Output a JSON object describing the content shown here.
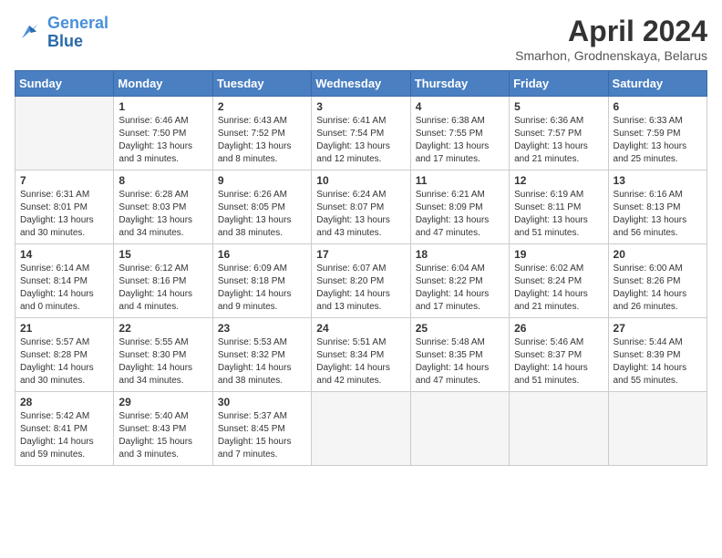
{
  "header": {
    "logo": "GeneralBlue",
    "month_title": "April 2024",
    "subtitle": "Smarhon, Grodnenskaya, Belarus"
  },
  "days_of_week": [
    "Sunday",
    "Monday",
    "Tuesday",
    "Wednesday",
    "Thursday",
    "Friday",
    "Saturday"
  ],
  "weeks": [
    [
      {
        "day": "",
        "content": []
      },
      {
        "day": "1",
        "content": [
          "Sunrise: 6:46 AM",
          "Sunset: 7:50 PM",
          "Daylight: 13 hours",
          "and 3 minutes."
        ]
      },
      {
        "day": "2",
        "content": [
          "Sunrise: 6:43 AM",
          "Sunset: 7:52 PM",
          "Daylight: 13 hours",
          "and 8 minutes."
        ]
      },
      {
        "day": "3",
        "content": [
          "Sunrise: 6:41 AM",
          "Sunset: 7:54 PM",
          "Daylight: 13 hours",
          "and 12 minutes."
        ]
      },
      {
        "day": "4",
        "content": [
          "Sunrise: 6:38 AM",
          "Sunset: 7:55 PM",
          "Daylight: 13 hours",
          "and 17 minutes."
        ]
      },
      {
        "day": "5",
        "content": [
          "Sunrise: 6:36 AM",
          "Sunset: 7:57 PM",
          "Daylight: 13 hours",
          "and 21 minutes."
        ]
      },
      {
        "day": "6",
        "content": [
          "Sunrise: 6:33 AM",
          "Sunset: 7:59 PM",
          "Daylight: 13 hours",
          "and 25 minutes."
        ]
      }
    ],
    [
      {
        "day": "7",
        "content": [
          "Sunrise: 6:31 AM",
          "Sunset: 8:01 PM",
          "Daylight: 13 hours",
          "and 30 minutes."
        ]
      },
      {
        "day": "8",
        "content": [
          "Sunrise: 6:28 AM",
          "Sunset: 8:03 PM",
          "Daylight: 13 hours",
          "and 34 minutes."
        ]
      },
      {
        "day": "9",
        "content": [
          "Sunrise: 6:26 AM",
          "Sunset: 8:05 PM",
          "Daylight: 13 hours",
          "and 38 minutes."
        ]
      },
      {
        "day": "10",
        "content": [
          "Sunrise: 6:24 AM",
          "Sunset: 8:07 PM",
          "Daylight: 13 hours",
          "and 43 minutes."
        ]
      },
      {
        "day": "11",
        "content": [
          "Sunrise: 6:21 AM",
          "Sunset: 8:09 PM",
          "Daylight: 13 hours",
          "and 47 minutes."
        ]
      },
      {
        "day": "12",
        "content": [
          "Sunrise: 6:19 AM",
          "Sunset: 8:11 PM",
          "Daylight: 13 hours",
          "and 51 minutes."
        ]
      },
      {
        "day": "13",
        "content": [
          "Sunrise: 6:16 AM",
          "Sunset: 8:13 PM",
          "Daylight: 13 hours",
          "and 56 minutes."
        ]
      }
    ],
    [
      {
        "day": "14",
        "content": [
          "Sunrise: 6:14 AM",
          "Sunset: 8:14 PM",
          "Daylight: 14 hours",
          "and 0 minutes."
        ]
      },
      {
        "day": "15",
        "content": [
          "Sunrise: 6:12 AM",
          "Sunset: 8:16 PM",
          "Daylight: 14 hours",
          "and 4 minutes."
        ]
      },
      {
        "day": "16",
        "content": [
          "Sunrise: 6:09 AM",
          "Sunset: 8:18 PM",
          "Daylight: 14 hours",
          "and 9 minutes."
        ]
      },
      {
        "day": "17",
        "content": [
          "Sunrise: 6:07 AM",
          "Sunset: 8:20 PM",
          "Daylight: 14 hours",
          "and 13 minutes."
        ]
      },
      {
        "day": "18",
        "content": [
          "Sunrise: 6:04 AM",
          "Sunset: 8:22 PM",
          "Daylight: 14 hours",
          "and 17 minutes."
        ]
      },
      {
        "day": "19",
        "content": [
          "Sunrise: 6:02 AM",
          "Sunset: 8:24 PM",
          "Daylight: 14 hours",
          "and 21 minutes."
        ]
      },
      {
        "day": "20",
        "content": [
          "Sunrise: 6:00 AM",
          "Sunset: 8:26 PM",
          "Daylight: 14 hours",
          "and 26 minutes."
        ]
      }
    ],
    [
      {
        "day": "21",
        "content": [
          "Sunrise: 5:57 AM",
          "Sunset: 8:28 PM",
          "Daylight: 14 hours",
          "and 30 minutes."
        ]
      },
      {
        "day": "22",
        "content": [
          "Sunrise: 5:55 AM",
          "Sunset: 8:30 PM",
          "Daylight: 14 hours",
          "and 34 minutes."
        ]
      },
      {
        "day": "23",
        "content": [
          "Sunrise: 5:53 AM",
          "Sunset: 8:32 PM",
          "Daylight: 14 hours",
          "and 38 minutes."
        ]
      },
      {
        "day": "24",
        "content": [
          "Sunrise: 5:51 AM",
          "Sunset: 8:34 PM",
          "Daylight: 14 hours",
          "and 42 minutes."
        ]
      },
      {
        "day": "25",
        "content": [
          "Sunrise: 5:48 AM",
          "Sunset: 8:35 PM",
          "Daylight: 14 hours",
          "and 47 minutes."
        ]
      },
      {
        "day": "26",
        "content": [
          "Sunrise: 5:46 AM",
          "Sunset: 8:37 PM",
          "Daylight: 14 hours",
          "and 51 minutes."
        ]
      },
      {
        "day": "27",
        "content": [
          "Sunrise: 5:44 AM",
          "Sunset: 8:39 PM",
          "Daylight: 14 hours",
          "and 55 minutes."
        ]
      }
    ],
    [
      {
        "day": "28",
        "content": [
          "Sunrise: 5:42 AM",
          "Sunset: 8:41 PM",
          "Daylight: 14 hours",
          "and 59 minutes."
        ]
      },
      {
        "day": "29",
        "content": [
          "Sunrise: 5:40 AM",
          "Sunset: 8:43 PM",
          "Daylight: 15 hours",
          "and 3 minutes."
        ]
      },
      {
        "day": "30",
        "content": [
          "Sunrise: 5:37 AM",
          "Sunset: 8:45 PM",
          "Daylight: 15 hours",
          "and 7 minutes."
        ]
      },
      {
        "day": "",
        "content": []
      },
      {
        "day": "",
        "content": []
      },
      {
        "day": "",
        "content": []
      },
      {
        "day": "",
        "content": []
      }
    ]
  ]
}
